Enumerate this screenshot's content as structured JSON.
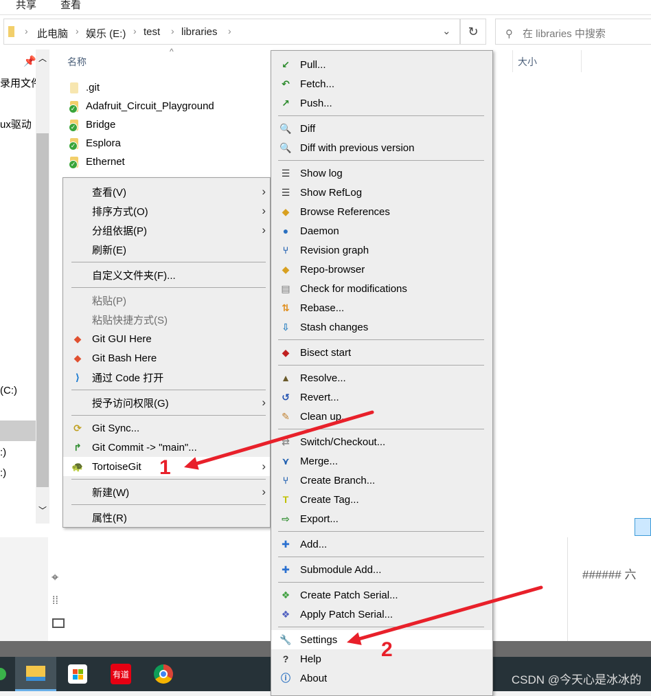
{
  "ribbon": {
    "share": "共享",
    "view": "查看"
  },
  "breadcrumb": [
    "此电脑",
    "娱乐 (E:)",
    "test",
    "libraries"
  ],
  "search": {
    "placeholder": "在 libraries 中搜索"
  },
  "columns": {
    "name": "名称",
    "size": "大小"
  },
  "nav": {
    "items": [
      "录用文件",
      "ux驱动",
      "(C:)",
      ":)",
      ":)"
    ]
  },
  "files": [
    ".git",
    "Adafruit_Circuit_Playground",
    "Bridge",
    "Esplora",
    "Ethernet"
  ],
  "explorer_menu": [
    {
      "label": "查看(V)",
      "submenu": true
    },
    {
      "label": "排序方式(O)",
      "submenu": true
    },
    {
      "label": "分组依据(P)",
      "submenu": true
    },
    {
      "label": "刷新(E)"
    },
    {
      "sep": true
    },
    {
      "label": "自定义文件夹(F)..."
    },
    {
      "sep": true
    },
    {
      "label": "粘贴(P)",
      "disabled": true
    },
    {
      "label": "粘贴快捷方式(S)",
      "disabled": true
    },
    {
      "label": "Git GUI Here",
      "icon": "git-gui-icon"
    },
    {
      "label": "Git Bash Here",
      "icon": "git-bash-icon"
    },
    {
      "label": "通过 Code 打开",
      "icon": "vscode-icon"
    },
    {
      "sep": true
    },
    {
      "label": "授予访问权限(G)",
      "submenu": true
    },
    {
      "sep": true
    },
    {
      "label": "Git Sync...",
      "icon": "sync-icon"
    },
    {
      "label": "Git Commit -> \"main\"...",
      "icon": "commit-icon"
    },
    {
      "label": "TortoiseGit",
      "icon": "tortoisegit-icon",
      "submenu": true,
      "highlighted": true
    },
    {
      "sep": true
    },
    {
      "label": "新建(W)",
      "submenu": true
    },
    {
      "sep": true
    },
    {
      "label": "属性(R)"
    }
  ],
  "tortoise_menu": [
    {
      "label": "Pull...",
      "icon": "pull-icon"
    },
    {
      "label": "Fetch...",
      "icon": "fetch-icon"
    },
    {
      "label": "Push...",
      "icon": "push-icon"
    },
    {
      "sep": true
    },
    {
      "label": "Diff",
      "icon": "diff-icon"
    },
    {
      "label": "Diff with previous version",
      "icon": "diff-icon"
    },
    {
      "sep": true
    },
    {
      "label": "Show log",
      "icon": "log-icon"
    },
    {
      "label": "Show RefLog",
      "icon": "log-icon"
    },
    {
      "label": "Browse References",
      "icon": "references-icon"
    },
    {
      "label": "Daemon",
      "icon": "daemon-icon"
    },
    {
      "label": "Revision graph",
      "icon": "revision-graph-icon"
    },
    {
      "label": "Repo-browser",
      "icon": "repo-browser-icon"
    },
    {
      "label": "Check for modifications",
      "icon": "check-modifications-icon"
    },
    {
      "label": "Rebase...",
      "icon": "rebase-icon"
    },
    {
      "label": "Stash changes",
      "icon": "stash-icon"
    },
    {
      "sep": true
    },
    {
      "label": "Bisect start",
      "icon": "bisect-icon"
    },
    {
      "sep": true
    },
    {
      "label": "Resolve...",
      "icon": "resolve-icon"
    },
    {
      "label": "Revert...",
      "icon": "revert-icon"
    },
    {
      "label": "Clean up...",
      "icon": "cleanup-icon"
    },
    {
      "sep": true
    },
    {
      "label": "Switch/Checkout...",
      "icon": "switch-icon"
    },
    {
      "label": "Merge...",
      "icon": "merge-icon"
    },
    {
      "label": "Create Branch...",
      "icon": "branch-icon"
    },
    {
      "label": "Create Tag...",
      "icon": "tag-icon"
    },
    {
      "label": "Export...",
      "icon": "export-icon"
    },
    {
      "sep": true
    },
    {
      "label": "Add...",
      "icon": "add-icon"
    },
    {
      "sep": true
    },
    {
      "label": "Submodule Add...",
      "icon": "add-icon"
    },
    {
      "sep": true
    },
    {
      "label": "Create Patch Serial...",
      "icon": "patch-icon"
    },
    {
      "label": "Apply Patch Serial...",
      "icon": "apply-patch-icon"
    },
    {
      "sep": true
    },
    {
      "label": "Settings",
      "icon": "settings-icon",
      "highlighted": true
    },
    {
      "label": "Help",
      "icon": "help-icon"
    },
    {
      "label": "About",
      "icon": "about-icon"
    }
  ],
  "annotations": {
    "one": "1",
    "two": "2",
    "arrow_color": "#e8202a"
  },
  "editor": {
    "heading": "###### 六"
  },
  "watermark": "CSDN @今天心是冰冰的",
  "taskbar": {
    "youdao": "有道"
  }
}
